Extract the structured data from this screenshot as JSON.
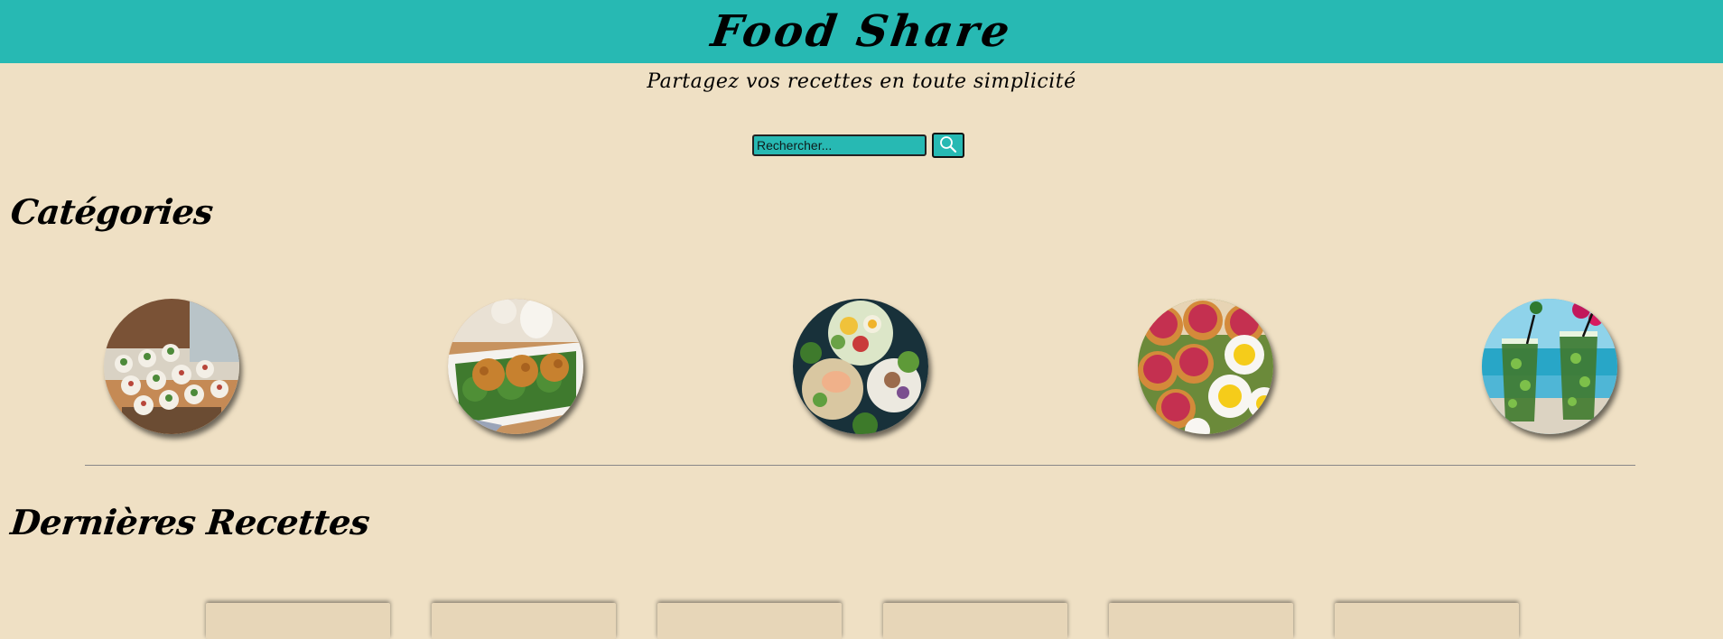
{
  "header": {
    "title": "Food Share"
  },
  "tagline": "Partagez vos recettes en toute simplicité",
  "search": {
    "placeholder": "Rechercher...",
    "value": "",
    "button_icon": "search-icon"
  },
  "sections": {
    "categories": "Catégories",
    "recent": "Dernières Recettes"
  },
  "categories": [
    {
      "icon": "appetizers-image"
    },
    {
      "icon": "main-dishes-image"
    },
    {
      "icon": "salad-bowls-image"
    },
    {
      "icon": "desserts-image"
    },
    {
      "icon": "drinks-image"
    }
  ],
  "colors": {
    "header": "#27b9b3",
    "background": "#efe0c4",
    "input": "#27b9b3"
  }
}
